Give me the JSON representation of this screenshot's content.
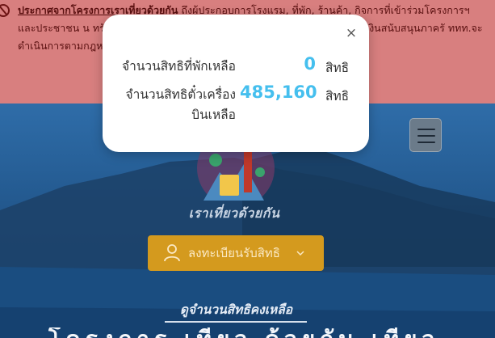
{
  "banner": {
    "heading": "ประกาศจากโครงการเราเที่ยวด้วยกัน",
    "body": " ถึงผู้ประกอบการโรงแรม, ที่พัก, ร้านค้า, กิจการที่เข้าร่วมโครงการฯ และประชาชน                                                            น ทรัพย์สิน ประโยชน์อื่นใด เป็นของตนเอง                                                              วยกัน เป็นเหตุให้ได้รับเงินสนับสนุนภาครั                                                                ททท.จะดำเนินการตามกฎหมายอย่างเด็ด"
  },
  "modal": {
    "close_glyph": "×",
    "room_label": "จำนวนสิทธิที่พักเหลือ",
    "room_value": "0",
    "room_unit": "สิทธิ",
    "flight_label_line1": "จำนวนสิทธิตั๋วเครื่อง",
    "flight_label_line2": "บินเหลือ",
    "flight_value": "485,160",
    "flight_unit": "สิทธิ"
  },
  "tagline": "เราเที่ยวด้วยกัน",
  "register_label": "ลงทะเบียนรับสิทธิ",
  "remaining_link": "ดูจำนวนสิทธิคงเหลือ",
  "bottom_text": "โครงการ เที่ยว ด้วยกัน เที่ยว",
  "colors": {
    "banner_bg": "#d87f7f",
    "register_bg": "#d49a1e",
    "value_blue": "#45bfee"
  },
  "icons": {
    "close": "close-icon",
    "menu": "hamburger-icon",
    "user": "user-icon",
    "chevron": "chevron-down-icon",
    "warning": "warning-icon"
  }
}
